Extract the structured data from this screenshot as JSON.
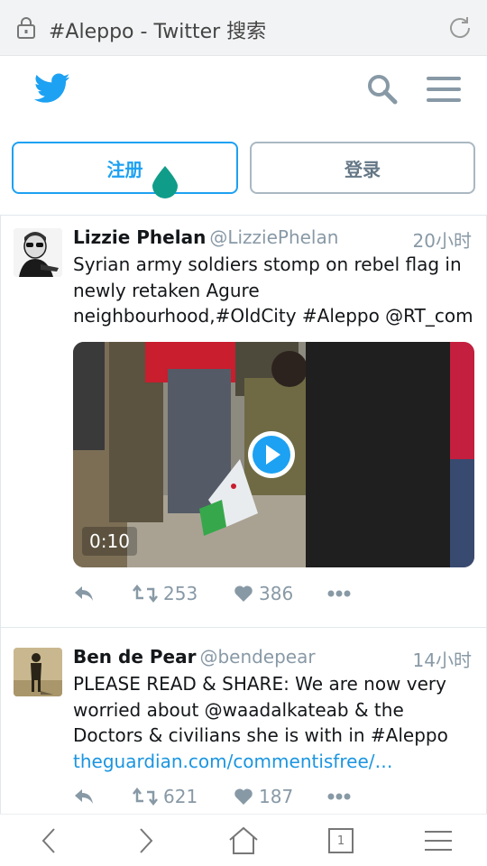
{
  "browser": {
    "page_title": "#Aleppo - Twitter 搜索",
    "tab_count": "1"
  },
  "header": {
    "logo_icon": "twitter-bird-icon",
    "search_icon": "search-icon",
    "menu_icon": "hamburger-menu-icon",
    "accent_color": "#1da1f2"
  },
  "auth": {
    "signup_label": "注册",
    "login_label": "登录"
  },
  "tweets": [
    {
      "name": "Lizzie Phelan",
      "handle": "@LizziePhelan",
      "time": "20小时",
      "text": "Syrian army soldiers stomp on rebel flag in newly retaken Agure neighbourhood,#OldCity #Aleppo @RT_com",
      "media_duration": "0:10",
      "retweets": "253",
      "likes": "386"
    },
    {
      "name": "Ben de Pear",
      "handle": "@bendepear",
      "time": "14小时",
      "text": "PLEASE READ & SHARE: We are now very worried about @waadalkateab & the Doctors & civilians she is with in #Aleppo",
      "link": "theguardian.com/commentisfree/…",
      "retweets": "621",
      "likes": "187"
    }
  ]
}
